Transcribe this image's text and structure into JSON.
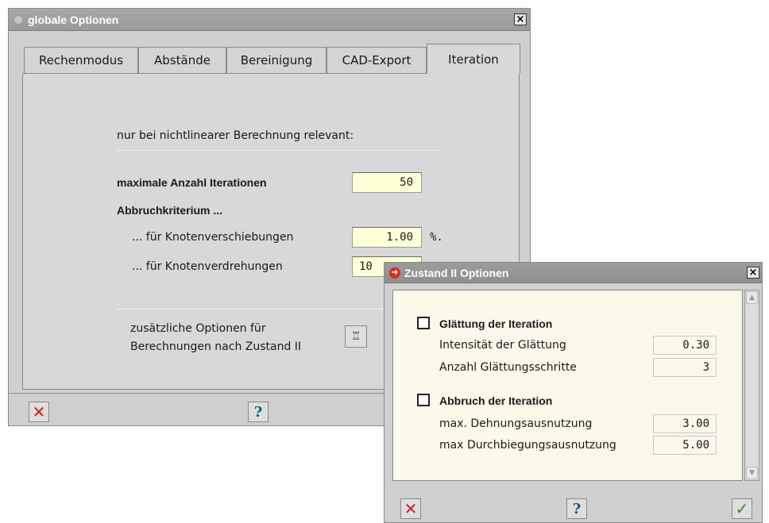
{
  "main_window": {
    "title": "globale Optionen",
    "close": "×",
    "tabs": [
      {
        "label": "Rechenmodus"
      },
      {
        "label": "Abstände"
      },
      {
        "label": "Bereinigung"
      },
      {
        "label": "CAD-Export"
      },
      {
        "label": "Iteration"
      }
    ],
    "active_tab": "Iteration",
    "intro": "nur bei nichtlinearer Berechnung relevant:",
    "max_iter_label": "maximale Anzahl Iterationen",
    "max_iter_value": "50",
    "abbruch_label": "Abbruchkriterium ...",
    "verschiebung_label": "... für Knotenverschiebungen",
    "verschiebung_value": "1.00",
    "verschiebung_unit": "%.",
    "verdrehung_label": "... für Knotenverdrehungen",
    "verdrehung_value": "10",
    "extra_line1": "zusätzliche Optionen für",
    "extra_line2": "Berechnungen nach Zustand II",
    "cancel_icon": "✕",
    "help_icon": "?"
  },
  "zustand_window": {
    "title": "Zustand II Optionen",
    "close": "×",
    "glaettung_label": "Glättung der Iteration",
    "glaettung_checked": false,
    "intensitaet_label": "Intensität der Glättung",
    "intensitaet_value": "0.30",
    "schritte_label": "Anzahl Glättungsschritte",
    "schritte_value": "3",
    "abbruch_label": "Abbruch der Iteration",
    "abbruch_checked": false,
    "dehnung_label": "max. Dehnungsausnutzung",
    "dehnung_value": "3.00",
    "durchbiegung_label": "max Durchbiegungsausnutzung",
    "durchbiegung_value": "5.00",
    "cancel_icon": "✕",
    "help_icon": "?",
    "ok_icon": "✓"
  }
}
